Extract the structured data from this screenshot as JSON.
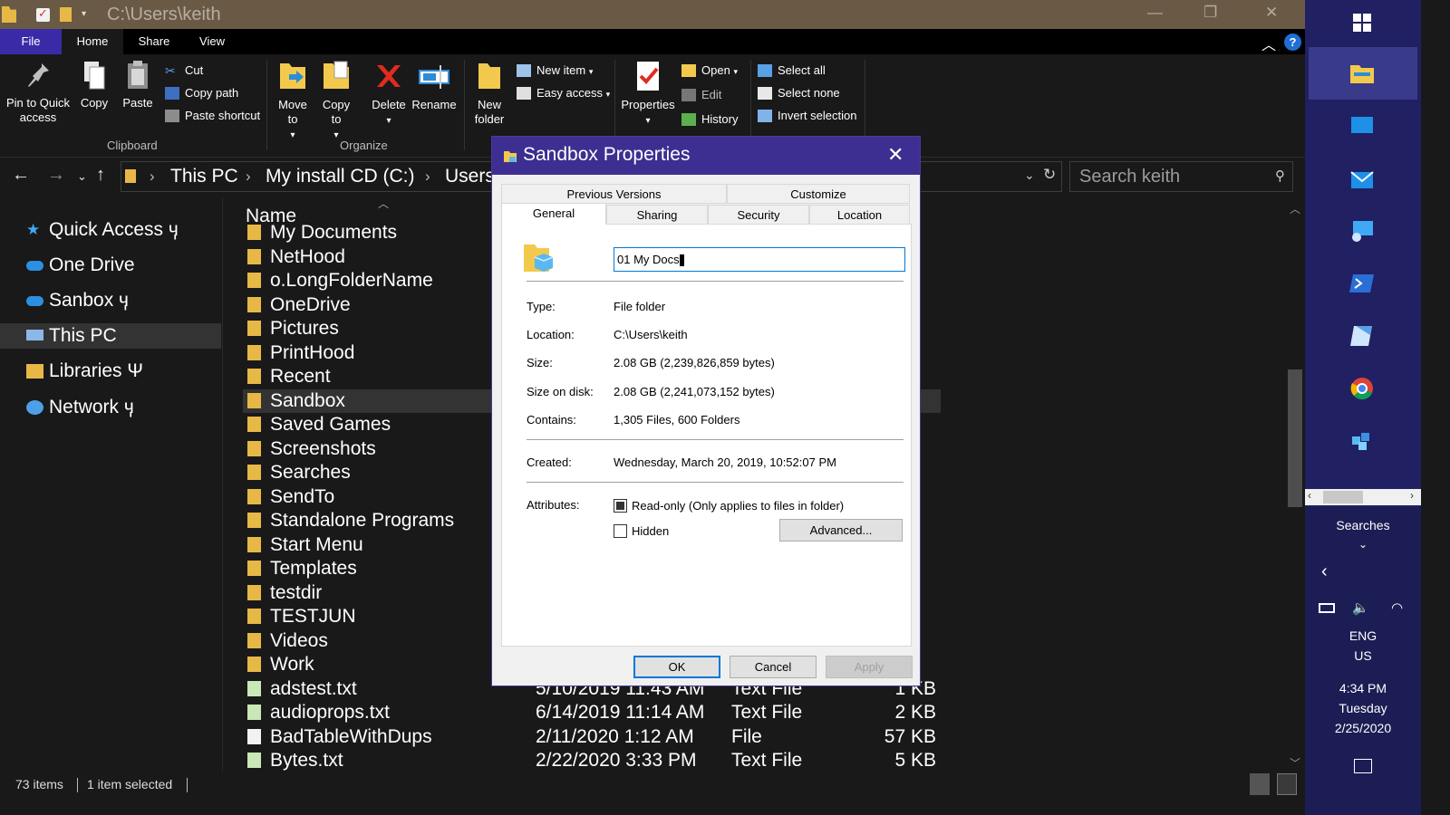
{
  "window": {
    "title": "C:\\Users\\keith",
    "minimize": "—",
    "maximize": "❐",
    "close": "✕"
  },
  "ribbon_tabs": [
    "File",
    "Home",
    "Share",
    "View"
  ],
  "ribbon": {
    "pin_label": "Pin to Quick access",
    "copy_label": "Copy",
    "paste_label": "Paste",
    "cut_label": "Cut",
    "copy_path_label": "Copy path",
    "paste_shortcut_label": "Paste shortcut",
    "clipboard_group": "Clipboard",
    "move_to_label": "Move to",
    "copy_to_label": "Copy to",
    "delete_label": "Delete",
    "rename_label": "Rename",
    "organize_group": "Organize",
    "new_folder_label": "New folder",
    "new_item_label": "New item",
    "easy_access_label": "Easy access",
    "properties_label": "Properties",
    "open_label": "Open",
    "edit_label": "Edit",
    "history_label": "History",
    "select_all_label": "Select all",
    "select_none_label": "Select none",
    "invert_selection_label": "Invert selection"
  },
  "address": {
    "crumbs": [
      "This PC",
      "My install CD (C:)",
      "Users"
    ],
    "search_placeholder": "Search keith"
  },
  "nav_pane": [
    {
      "label": "Quick Access ӌ"
    },
    {
      "label": "One Drive"
    },
    {
      "label": "Sanbox ӌ"
    },
    {
      "label": "This PC"
    },
    {
      "label": "Libraries Ψ"
    },
    {
      "label": "Network ӌ"
    }
  ],
  "file_list": {
    "name_header": "Name",
    "rows": [
      {
        "name": "My Documents",
        "date": "",
        "type": "",
        "size": ""
      },
      {
        "name": "NetHood",
        "date": "",
        "type": "",
        "size": ""
      },
      {
        "name": "o.LongFolderName",
        "date": "",
        "type": "",
        "size": ""
      },
      {
        "name": "OneDrive",
        "date": "",
        "type": "",
        "size": ""
      },
      {
        "name": "Pictures",
        "date": "",
        "type": "",
        "size": ""
      },
      {
        "name": "PrintHood",
        "date": "",
        "type": "",
        "size": ""
      },
      {
        "name": "Recent",
        "date": "",
        "type": "",
        "size": ""
      },
      {
        "name": "Sandbox",
        "date": "",
        "type": "",
        "size": ""
      },
      {
        "name": "Saved Games",
        "date": "",
        "type": "",
        "size": ""
      },
      {
        "name": "Screenshots",
        "date": "",
        "type": "",
        "size": ""
      },
      {
        "name": "Searches",
        "date": "",
        "type": "",
        "size": ""
      },
      {
        "name": "SendTo",
        "date": "",
        "type": "",
        "size": ""
      },
      {
        "name": "Standalone Programs",
        "date": "",
        "type": "",
        "size": ""
      },
      {
        "name": "Start Menu",
        "date": "",
        "type": "",
        "size": ""
      },
      {
        "name": "Templates",
        "date": "",
        "type": "",
        "size": ""
      },
      {
        "name": "testdir",
        "date": "",
        "type": "",
        "size": ""
      },
      {
        "name": "TESTJUN",
        "date": "",
        "type": "",
        "size": ""
      },
      {
        "name": "Videos",
        "date": "",
        "type": "",
        "size": ""
      },
      {
        "name": "Work",
        "date": "",
        "type": "",
        "size": ""
      },
      {
        "name": "adstest.txt",
        "date": "5/10/2019 11:43 AM",
        "type": "Text File",
        "size": "1 KB"
      },
      {
        "name": "audioprops.txt",
        "date": "6/14/2019 11:14 AM",
        "type": "Text File",
        "size": "2 KB"
      },
      {
        "name": "BadTableWithDups",
        "date": "2/11/2020 1:12 AM",
        "type": "File",
        "size": "57 KB"
      },
      {
        "name": "Bytes.txt",
        "date": "2/22/2020 3:33 PM",
        "type": "Text File",
        "size": "5 KB"
      }
    ]
  },
  "status": {
    "items": "73 items",
    "selected": "1 item selected"
  },
  "taskbar": {
    "searches_label": "Searches",
    "lang1": "ENG",
    "lang2": "US",
    "time": "4:34 PM",
    "day": "Tuesday",
    "date": "2/25/2020"
  },
  "dialog": {
    "title": "Sandbox Properties",
    "close": "✕",
    "tabs_row1": [
      "Previous Versions",
      "Customize"
    ],
    "tabs_row2": [
      "General",
      "Sharing",
      "Security",
      "Location"
    ],
    "name_value": "01 My Docs",
    "type_label": "Type:",
    "type_value": "File folder",
    "location_label": "Location:",
    "location_value": "C:\\Users\\keith",
    "size_label": "Size:",
    "size_value": "2.08 GB (2,239,826,859 bytes)",
    "size_on_disk_label": "Size on disk:",
    "size_on_disk_value": "2.08 GB (2,241,073,152 bytes)",
    "contains_label": "Contains:",
    "contains_value": "1,305 Files, 600 Folders",
    "created_label": "Created:",
    "created_value": "Wednesday, March 20, 2019, 10:52:07 PM",
    "attributes_label": "Attributes:",
    "readonly_label": "Read-only (Only applies to files in folder)",
    "hidden_label": "Hidden",
    "advanced_label": "Advanced...",
    "ok_label": "OK",
    "cancel_label": "Cancel",
    "apply_label": "Apply"
  },
  "colors": {
    "accent": "#3d2f91",
    "file_tab": "#3a2aa8",
    "taskbar": "#202062",
    "folder": "#e8b847"
  }
}
